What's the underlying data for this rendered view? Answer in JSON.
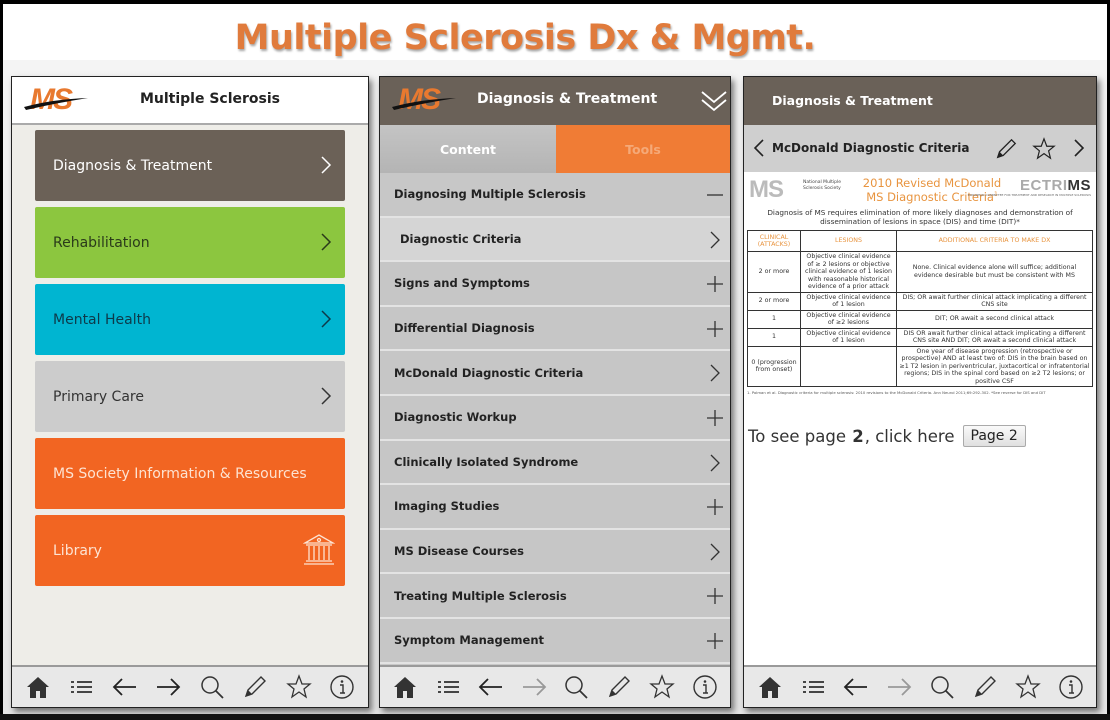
{
  "page_title": "Multiple Sclerosis Dx & Mgmt.",
  "colors": {
    "title_orange": "#e07b3c",
    "header_brown": "#6a6158",
    "tile_brown": "#6b6157",
    "tile_green": "#8cc63f",
    "tile_cyan": "#00b5d1",
    "tile_gray": "#cccccc",
    "tile_orange": "#f26522",
    "tab_orange": "#f07c35"
  },
  "screen1": {
    "logo": "MS",
    "header_title": "Multiple Sclerosis",
    "tiles": [
      {
        "label": "Diagnosis & Treatment",
        "icon": "chevron-right-icon"
      },
      {
        "label": "Rehabilitation",
        "icon": "chevron-right-icon"
      },
      {
        "label": "Mental Health",
        "icon": "chevron-right-icon"
      },
      {
        "label": "Primary Care",
        "icon": "chevron-right-icon"
      },
      {
        "label": "MS Society Information & Resources",
        "icon": ""
      },
      {
        "label": "Library",
        "icon": "library-icon"
      }
    ]
  },
  "screen2": {
    "logo": "MS",
    "header_title": "Diagnosis & Treatment",
    "header_icon": "double-chevron-down-icon",
    "tabs": [
      {
        "label": "Content",
        "active": true
      },
      {
        "label": "Tools",
        "active": false
      }
    ],
    "items": [
      {
        "label": "Diagnosing Multiple Sclerosis",
        "icon": "minus-icon",
        "type": "expanded"
      },
      {
        "label": "Diagnostic Criteria",
        "icon": "chevron-right-icon",
        "type": "sub"
      },
      {
        "label": "Signs and Symptoms",
        "icon": "plus-icon"
      },
      {
        "label": "Differential Diagnosis",
        "icon": "plus-icon"
      },
      {
        "label": "McDonald Diagnostic Criteria",
        "icon": "chevron-right-icon"
      },
      {
        "label": "Diagnostic Workup",
        "icon": "plus-icon"
      },
      {
        "label": "Clinically Isolated Syndrome",
        "icon": "chevron-right-icon"
      },
      {
        "label": "Imaging Studies",
        "icon": "plus-icon"
      },
      {
        "label": "MS Disease Courses",
        "icon": "chevron-right-icon"
      },
      {
        "label": "Treating Multiple Sclerosis",
        "icon": "plus-icon"
      },
      {
        "label": "Symptom Management",
        "icon": "plus-icon"
      }
    ]
  },
  "screen3": {
    "header_title": "Diagnosis & Treatment",
    "nav_title": "McDonald Diagnostic Criteria",
    "document": {
      "org_logo": "MS",
      "org_name": "National Multiple Sclerosis Society",
      "title_line1": "2010 Revised McDonald",
      "title_line2": "MS Diagnostic Criteria",
      "title_sup": "1",
      "partner_logo_a": "ECTRI",
      "partner_logo_b": "MS",
      "partner_subtitle": "EUROPEAN COMMITTEE FOR TREATMENT AND RESEARCH IN MULTIPLE SCLEROSIS",
      "intro": "Diagnosis of MS requires elimination of more likely diagnoses and demonstration of dissemination of lesions in space (DIS) and time (DIT)*",
      "columns": [
        "CLINICAL (ATTACKS)",
        "LESIONS",
        "ADDITIONAL CRITERIA TO MAKE DX"
      ],
      "rows": [
        [
          "2 or more",
          "Objective clinical evidence of ≥ 2 lesions or objective clinical evidence of 1 lesion with reasonable historical evidence of a prior attack",
          "None. Clinical evidence alone will suffice; additional evidence desirable but must be consistent with MS"
        ],
        [
          "2 or more",
          "Objective clinical evidence of 1 lesion",
          "DIS; OR await further clinical attack implicating a different CNS site"
        ],
        [
          "1",
          "Objective clinical evidence of ≥2 lesions",
          "DIT; OR await a second clinical attack"
        ],
        [
          "1",
          "Objective clinical evidence of 1 lesion",
          "DIS OR await further clinical attack implicating a different CNS site AND DIT; OR await a second clinical attack"
        ],
        [
          "0 (progression from onset)",
          "",
          "One year of disease progression (retrospective or prospective) AND at least two of: DIS in the brain based on ≥1 T2 lesion in periventricular, juxtacortical or infratentorial regions; DIS in the spinal cord based on ≥2 T2 lesions; or positive CSF"
        ]
      ],
      "footnote": "1. Polman et al. Diagnostic criteria for multiple sclerosis: 2010 revisions to the McDonald Criteria. Ann Neurol 2011;69:292-302. *See reverse for DIS and DIT"
    },
    "page_link_prefix": "To see page ",
    "page_link_number": "2",
    "page_link_suffix": ", click here",
    "page_button": "Page 2"
  },
  "toolbar": {
    "icons": [
      "home-icon",
      "list-icon",
      "back-arrow-icon",
      "forward-arrow-icon",
      "search-icon",
      "pencil-icon",
      "star-icon",
      "info-icon"
    ]
  }
}
